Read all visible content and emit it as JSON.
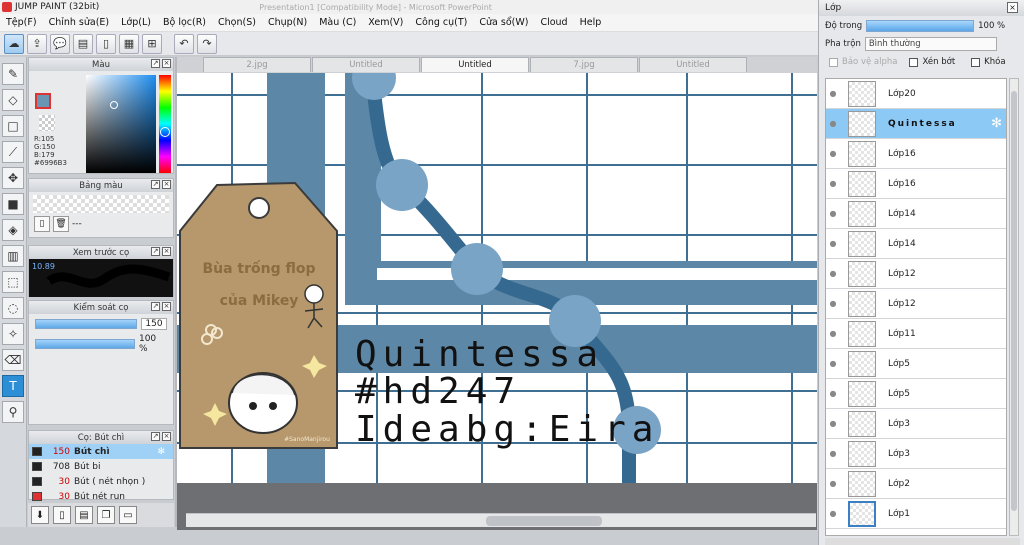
{
  "window": {
    "title": "JUMP PAINT (32bit)",
    "ghost_title": "Presentation1 [Compatibility Mode] - Microsoft PowerPoint"
  },
  "menu": [
    "Tệp(F)",
    "Chỉnh sửa(E)",
    "Lớp(L)",
    "Bộ lọc(R)",
    "Chọn(S)",
    "Chụp(N)",
    "Màu (C)",
    "Xem(V)",
    "Công cụ(T)",
    "Cửa sổ(W)",
    "Cloud",
    "Help"
  ],
  "color_panel": {
    "title": "Màu",
    "r": "R:105",
    "g": "G:150",
    "b": "B:179",
    "hex": "#6996B3",
    "fg": "#6996b3"
  },
  "swatch_panel": {
    "title": "Bảng màu",
    "dash": "---"
  },
  "preview_panel": {
    "title": "Xem trước cọ",
    "size": "10.89"
  },
  "control_panel": {
    "title": "Kiểm soát cọ",
    "size": "150",
    "opacity": "100 %"
  },
  "brush_panel": {
    "title": "Cọ: Bút chì",
    "items": [
      {
        "size": "150",
        "name": "Bút chì",
        "color": "#222"
      },
      {
        "size": "708",
        "name": "Bút bi",
        "color": "#222"
      },
      {
        "size": "30",
        "name": "Bút ( nét nhọn )",
        "color": "#222"
      },
      {
        "size": "30",
        "name": "Bút nét run",
        "color": "#d33"
      }
    ]
  },
  "tabs": [
    "2.jpg",
    "Untitled",
    "Untitled",
    "7.jpg",
    "Untitled"
  ],
  "active_tab": 2,
  "artwork": {
    "tag_line1": "Bùa trống flop",
    "tag_line2": "của Mikey",
    "tag_credit": "#SanoManjirou",
    "big_line1": "Quintessa",
    "big_line2": "#hd247",
    "big_line3": "Ideabg:Eira",
    "colors": {
      "bg": "#ffffff",
      "grid": "#3f6f93",
      "band": "#5d87a6",
      "path": "#35698f",
      "dot": "#7aa4c6",
      "tag": "#b6986c",
      "floor": "#6d6f73"
    }
  },
  "layer_panel": {
    "title": "Lớp",
    "opacity_label": "Độ trong",
    "opacity_value": "100 %",
    "blend_label": "Pha trộn",
    "blend_value": "Bình thường",
    "alpha_label": "Bảo vệ alpha",
    "clip_label": "Xén bớt",
    "lock_label": "Khóa",
    "layers": [
      {
        "name": "Lớp20"
      },
      {
        "name": "Quintessa",
        "selected": true
      },
      {
        "name": "Lớp16"
      },
      {
        "name": "Lớp16"
      },
      {
        "name": "Lớp14"
      },
      {
        "name": "Lớp14"
      },
      {
        "name": "Lớp12"
      },
      {
        "name": "Lớp12"
      },
      {
        "name": "Lớp11"
      },
      {
        "name": "Lớp5"
      },
      {
        "name": "Lớp5"
      },
      {
        "name": "Lớp3"
      },
      {
        "name": "Lớp3"
      },
      {
        "name": "Lớp2"
      },
      {
        "name": "Lớp1"
      }
    ]
  }
}
